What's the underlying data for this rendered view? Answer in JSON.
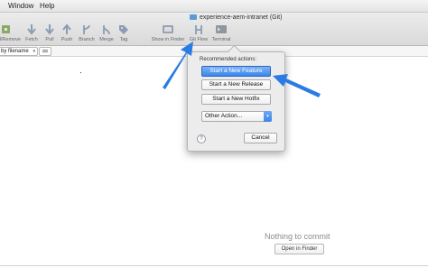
{
  "menubar": {
    "items": [
      "Window",
      "Help"
    ]
  },
  "window": {
    "title": "experience-aem-intranet (Git)"
  },
  "toolbar": {
    "items": [
      {
        "label": "Add/Remove",
        "icon": "add-remove-icon"
      },
      {
        "label": "Fetch",
        "icon": "fetch-icon"
      },
      {
        "label": "Pull",
        "icon": "pull-icon"
      },
      {
        "label": "Push",
        "icon": "push-icon"
      },
      {
        "label": "Branch",
        "icon": "branch-icon"
      },
      {
        "label": "Merge",
        "icon": "merge-icon"
      },
      {
        "label": "Tag",
        "icon": "tag-icon"
      },
      {
        "label": "Show in Finder",
        "icon": "show-in-finder-icon"
      },
      {
        "label": "Git Flow",
        "icon": "git-flow-icon"
      },
      {
        "label": "Terminal",
        "icon": "terminal-icon"
      }
    ]
  },
  "filter": {
    "sort_value": "by filename"
  },
  "popup": {
    "heading": "Recommended actions:",
    "buttons": [
      "Start a New Feature",
      "Start a New Release",
      "Start a New Hotfix"
    ],
    "other_action": "Other Action...",
    "help": "?",
    "cancel": "Cancel"
  },
  "empty_state": {
    "message": "Nothing to commit",
    "button": "Open in Finder"
  },
  "colors": {
    "accent": "#3a86ec",
    "annotation_arrow": "#2a7be4"
  }
}
